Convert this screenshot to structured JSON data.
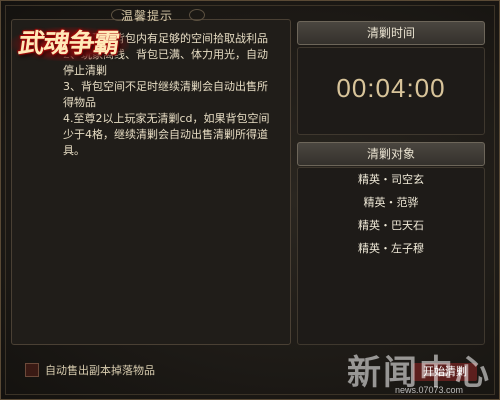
{
  "logo": {
    "text": "武魂争霸"
  },
  "tips_panel": {
    "title": "温馨提示",
    "tips": [
      "1、请确保背包内有足够的空间拾取战利品",
      "2、玩家离线、背包已满、体力用光，自动停止清剿",
      "3、背包空间不足时继续清剿会自动出售所得物品",
      "4.至尊2以上玩家无清剿cd，如果背包空间少于4格，继续清剿会自动出售清剿所得道具。"
    ]
  },
  "timer_panel": {
    "title": "清剿时间",
    "time": "00:04:00"
  },
  "targets_panel": {
    "title": "清剿对象",
    "targets": [
      "精英・司空玄",
      "精英・范骅",
      "精英・巴天石",
      "精英・左子穆"
    ]
  },
  "auto_sell": {
    "label": "自动售出副本掉落物品",
    "checked": false
  },
  "action_button": {
    "label": "开始清剿"
  },
  "watermark": {
    "text": "新闻中心",
    "sub": "news.07073.com"
  }
}
